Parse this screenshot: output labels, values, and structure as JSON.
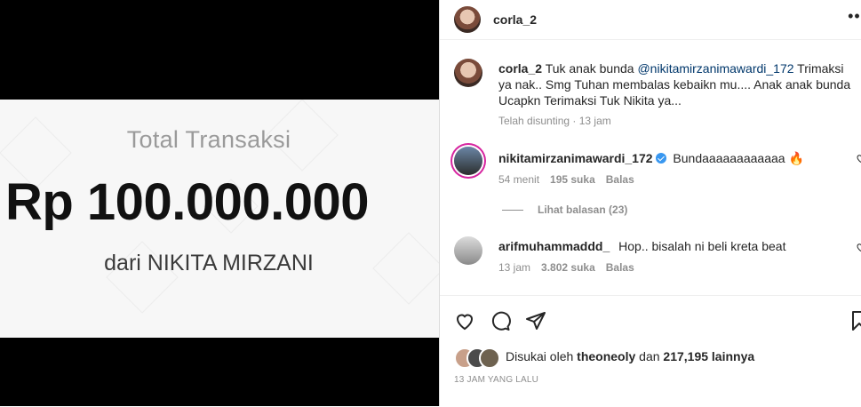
{
  "post": {
    "username": "corla_2",
    "more_glyph": "•••"
  },
  "media": {
    "label": "Total Transaksi",
    "amount": "Rp 100.000.000",
    "from": "dari NIKITA MIRZANI"
  },
  "caption": {
    "username": "corla_2",
    "text_before": "Tuk anak bunda ",
    "mention": "@nikitamirzanimawardi_172",
    "text_after": " Trimaksi ya nak.. Smg Tuhan membalas kebaikn mu.... Anak anak bunda Ucapkn Terimaksi Tuk Nikita ya...",
    "meta": "Telah disunting · 13 jam"
  },
  "comments": [
    {
      "username": "nikitamirzanimawardi_172",
      "text": "Bundaaaaaaaaaaaa 🔥",
      "time": "54 menit",
      "likes": "195 suka",
      "reply": "Balas",
      "view_replies": "Lihat balasan (23)"
    },
    {
      "username": "arifmuhammaddd_",
      "text": "Hop.. bisalah ni beli kreta beat",
      "time": "13 jam",
      "likes": "3.802 suka",
      "reply": "Balas"
    }
  ],
  "likes": {
    "prefix": "Disukai oleh ",
    "user": "theoneoly",
    "middle": " dan ",
    "count": "217,195 lainnya"
  },
  "timestamp": "13 JAM YANG LALU",
  "icons": [
    "heart-icon",
    "comment-icon",
    "share-icon",
    "bookmark-icon"
  ]
}
